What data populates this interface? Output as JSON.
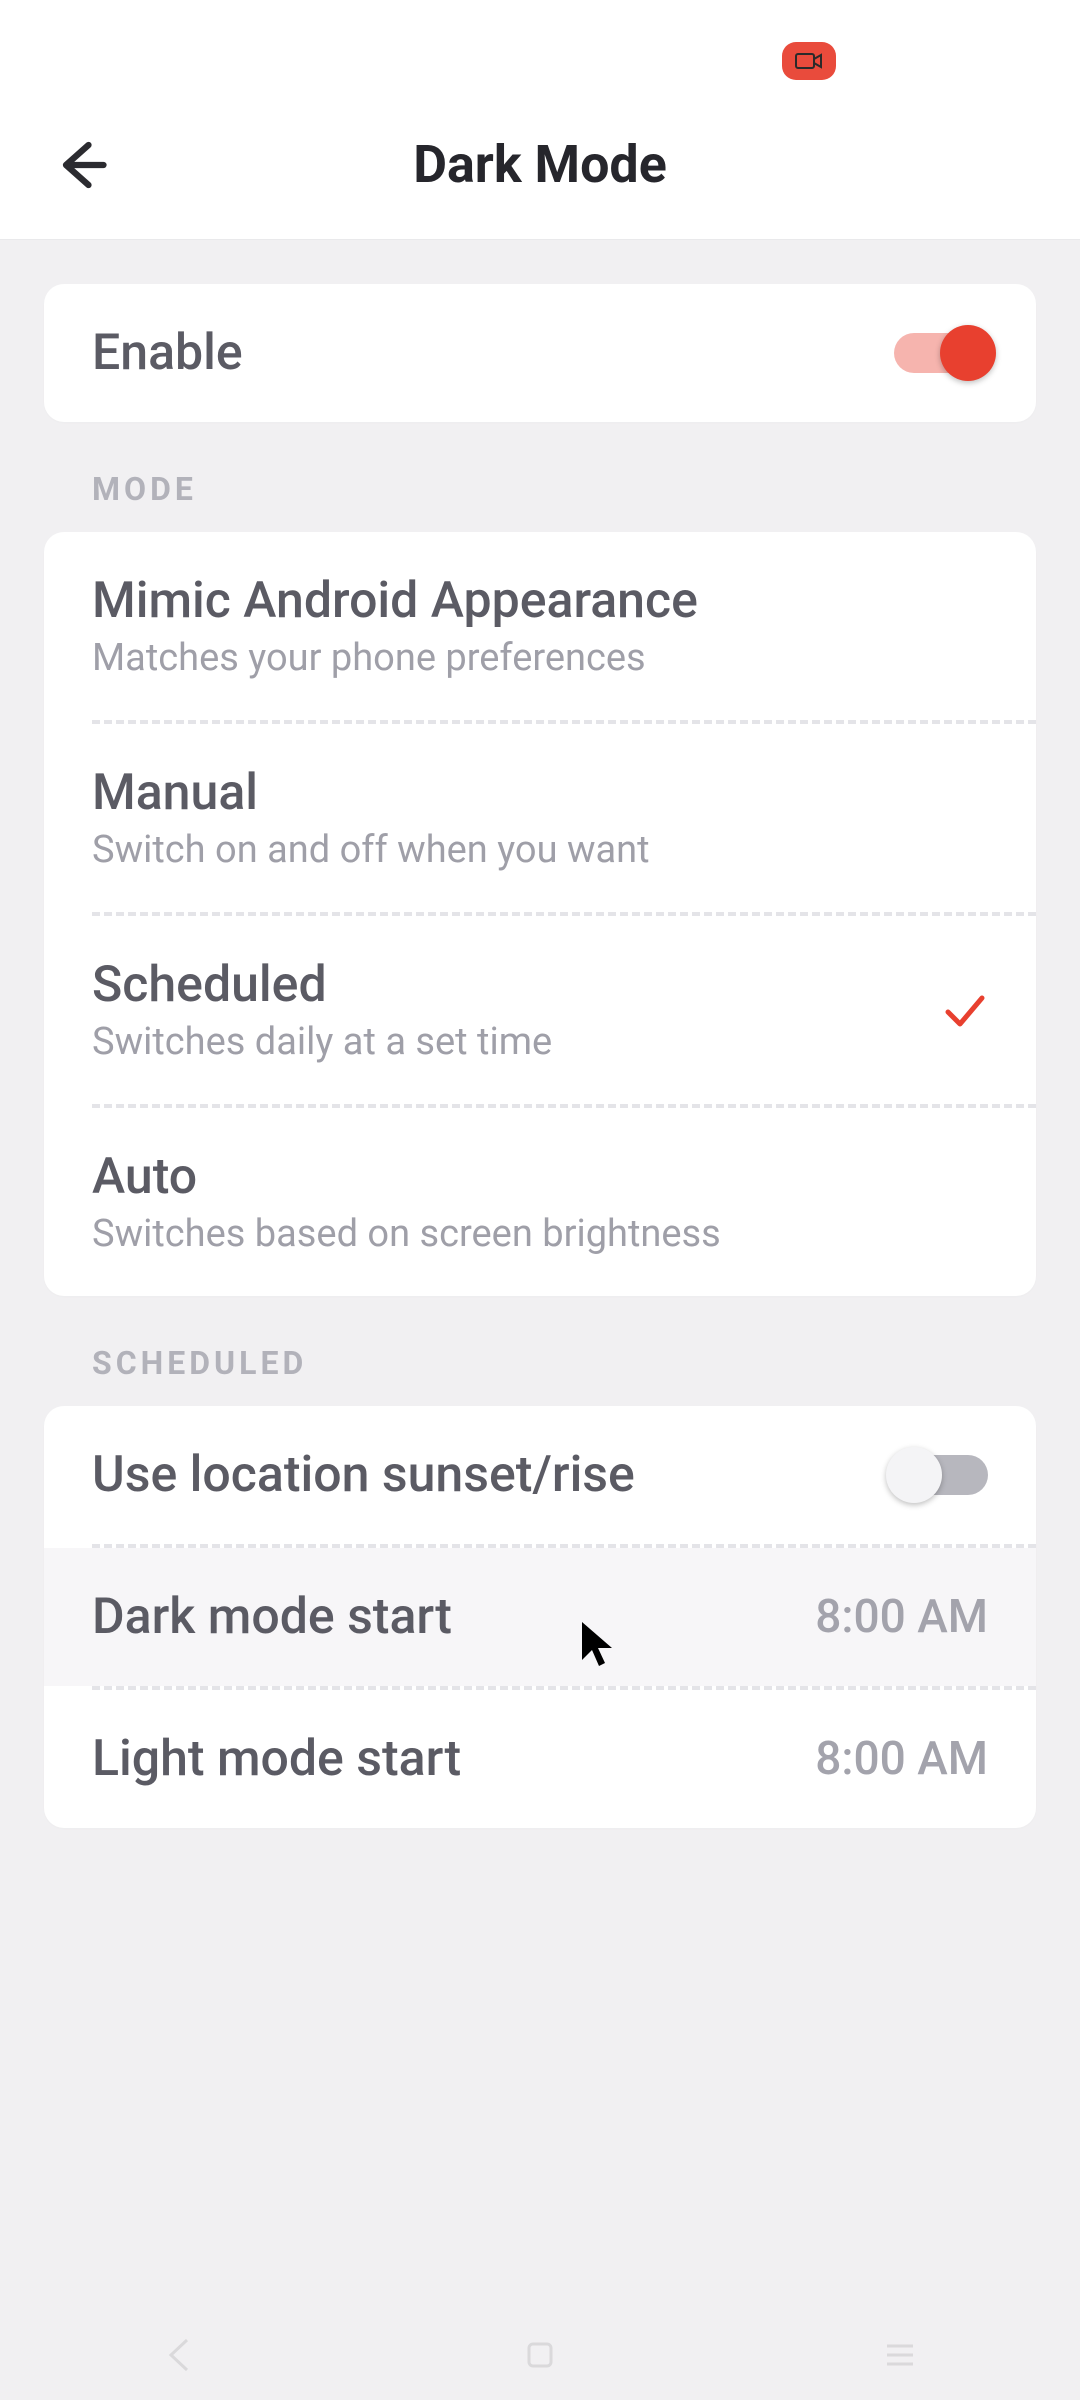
{
  "header": {
    "title": "Dark Mode"
  },
  "enable": {
    "label": "Enable",
    "on": true
  },
  "sections": {
    "mode": {
      "header": "MODE",
      "options": [
        {
          "title": "Mimic Android Appearance",
          "subtitle": "Matches your phone preferences",
          "selected": false
        },
        {
          "title": "Manual",
          "subtitle": "Switch on and off when you want",
          "selected": false
        },
        {
          "title": "Scheduled",
          "subtitle": "Switches daily at a set time",
          "selected": true
        },
        {
          "title": "Auto",
          "subtitle": "Switches based on screen brightness",
          "selected": false
        }
      ]
    },
    "scheduled": {
      "header": "SCHEDULED",
      "use_location": {
        "label": "Use location sunset/rise",
        "on": false
      },
      "dark_start": {
        "label": "Dark mode start",
        "value": "8:00 AM"
      },
      "light_start": {
        "label": "Light mode start",
        "value": "8:00 AM"
      }
    }
  },
  "colors": {
    "accent": "#e8402f"
  }
}
